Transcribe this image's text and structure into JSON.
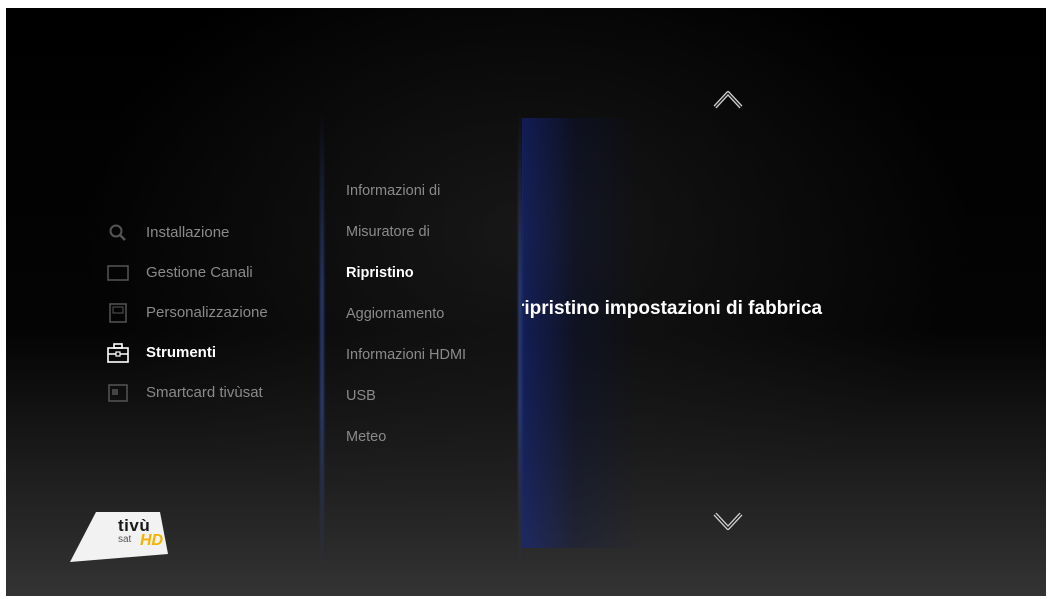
{
  "main_menu": {
    "items": [
      {
        "label": "Installazione",
        "icon": "search-icon"
      },
      {
        "label": "Gestione Canali",
        "icon": "tv-icon"
      },
      {
        "label": "Personalizzazione",
        "icon": "customize-icon"
      },
      {
        "label": "Strumenti",
        "icon": "toolbox-icon",
        "active": true
      },
      {
        "label": "Smartcard tivùsat",
        "icon": "smartcard-icon"
      }
    ]
  },
  "sub_menu": {
    "items": [
      {
        "label": "Informazioni di"
      },
      {
        "label": "Misuratore di"
      },
      {
        "label": "Ripristino",
        "active": true
      },
      {
        "label": "Aggiornamento"
      },
      {
        "label": "Informazioni HDMI"
      },
      {
        "label": "USB"
      },
      {
        "label": "Meteo"
      }
    ]
  },
  "detail": {
    "text": "ripristino impostazioni di fabbrica"
  },
  "navigation": {
    "up_icon": "chevron-up-icon",
    "down_icon": "chevron-down-icon"
  },
  "logo": {
    "brand": "tivù",
    "sub": "sat",
    "hd": "HD"
  },
  "colors": {
    "background": "#000000",
    "active_text": "#ffffff",
    "inactive_text": "#8a8a8a",
    "accent_blue": "#3c5ab4",
    "logo_hd": "#f2b400"
  }
}
